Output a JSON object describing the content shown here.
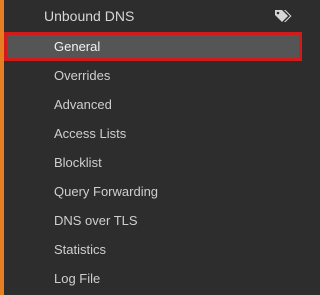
{
  "section": {
    "title": "Unbound DNS",
    "icon": "tags-icon"
  },
  "menu": {
    "items": [
      {
        "label": "General",
        "active": true
      },
      {
        "label": "Overrides"
      },
      {
        "label": "Advanced"
      },
      {
        "label": "Access Lists"
      },
      {
        "label": "Blocklist"
      },
      {
        "label": "Query Forwarding"
      },
      {
        "label": "DNS over TLS"
      },
      {
        "label": "Statistics"
      },
      {
        "label": "Log File"
      }
    ]
  },
  "colors": {
    "background": "#2d2d2d",
    "accent": "#e67e22",
    "active_background": "#555555",
    "highlight_border": "#d11a1a",
    "text": "#cfcfcf"
  }
}
